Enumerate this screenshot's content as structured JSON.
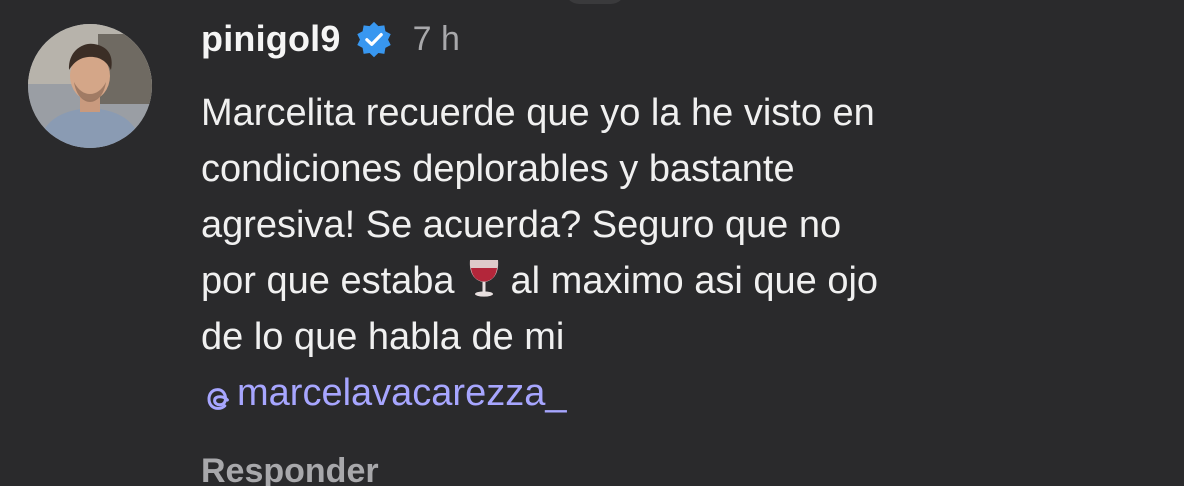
{
  "comment": {
    "username": "pinigol9",
    "time": "7 h",
    "lines": [
      "Marcelita recuerde que yo la he visto en",
      "condiciones deplorables y bastante",
      "agresiva! Se acuerda? Seguro que no"
    ],
    "line4_before_emoji": "por que estaba",
    "emoji": "wine-glass-icon",
    "line4_after_emoji": "al maximo asi que ojo",
    "line5": "de lo que habla de mi",
    "mention": "marcelavacarezza_",
    "reply_label": "Responder"
  },
  "colors": {
    "background": "#2a2a2c",
    "text": "#f0f0f0",
    "secondary": "#a8a8ab",
    "mention": "#a7a6ff",
    "verified": "#3897f0"
  }
}
